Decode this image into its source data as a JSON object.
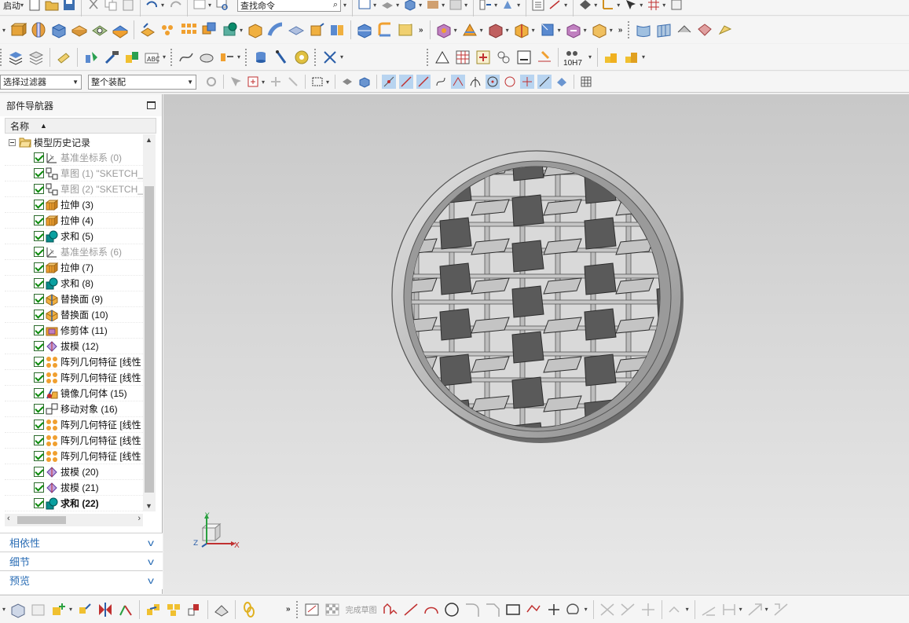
{
  "toolbar": {
    "start_label": "启动",
    "search_placeholder": "查找命令",
    "filter_value": "选择过滤器",
    "scope_value": "整个装配",
    "tolerance_label": "10H7"
  },
  "navigator": {
    "title": "部件导航器",
    "column_name": "名称",
    "root_label": "模型历史记录",
    "items": [
      {
        "label": "基准坐标系 (0)",
        "icon": "datum-csys-icon",
        "dim": true
      },
      {
        "label": "草图 (1) \"SKETCH_",
        "icon": "sketch-icon",
        "dim": true
      },
      {
        "label": "草图 (2) \"SKETCH_",
        "icon": "sketch-icon",
        "dim": true
      },
      {
        "label": "拉伸 (3)",
        "icon": "extrude-icon",
        "dim": false
      },
      {
        "label": "拉伸 (4)",
        "icon": "extrude-icon",
        "dim": false
      },
      {
        "label": "求和 (5)",
        "icon": "unite-icon",
        "dim": false
      },
      {
        "label": "基准坐标系 (6)",
        "icon": "datum-csys-icon",
        "dim": true
      },
      {
        "label": "拉伸 (7)",
        "icon": "extrude-icon",
        "dim": false
      },
      {
        "label": "求和 (8)",
        "icon": "unite-icon",
        "dim": false
      },
      {
        "label": "替换面 (9)",
        "icon": "replace-face-icon",
        "dim": false
      },
      {
        "label": "替换面 (10)",
        "icon": "replace-face-icon",
        "dim": false
      },
      {
        "label": "修剪体 (11)",
        "icon": "trim-body-icon",
        "dim": false
      },
      {
        "label": "拔模 (12)",
        "icon": "draft-icon",
        "dim": false
      },
      {
        "label": "阵列几何特征 [线性",
        "icon": "pattern-geometry-icon",
        "dim": false
      },
      {
        "label": "阵列几何特征 [线性",
        "icon": "pattern-geometry-icon",
        "dim": false
      },
      {
        "label": "镜像几何体 (15)",
        "icon": "mirror-geometry-icon",
        "dim": false
      },
      {
        "label": "移动对象 (16)",
        "icon": "move-object-icon",
        "dim": false
      },
      {
        "label": "阵列几何特征 [线性",
        "icon": "pattern-geometry-icon",
        "dim": false
      },
      {
        "label": "阵列几何特征 [线性",
        "icon": "pattern-geometry-icon",
        "dim": false
      },
      {
        "label": "阵列几何特征 [线性",
        "icon": "pattern-geometry-icon",
        "dim": false
      },
      {
        "label": "拔模 (20)",
        "icon": "draft-icon",
        "dim": false
      },
      {
        "label": "拔模 (21)",
        "icon": "draft-icon",
        "dim": false
      },
      {
        "label": "求和 (22)",
        "icon": "unite-icon",
        "dim": false,
        "bold": true
      }
    ],
    "panels": [
      "相依性",
      "细节",
      "预览"
    ]
  },
  "viewport": {
    "triad_x": "X",
    "triad_y": "Y",
    "triad_z": "Z"
  },
  "bottom": {
    "finish_sketch_label": "完成草图"
  },
  "colors": {
    "check_green": "#0a8a0a",
    "panel_blue": "#2a6db5",
    "part_dark": "#5a5a5a",
    "part_light": "#c4c4c4"
  }
}
